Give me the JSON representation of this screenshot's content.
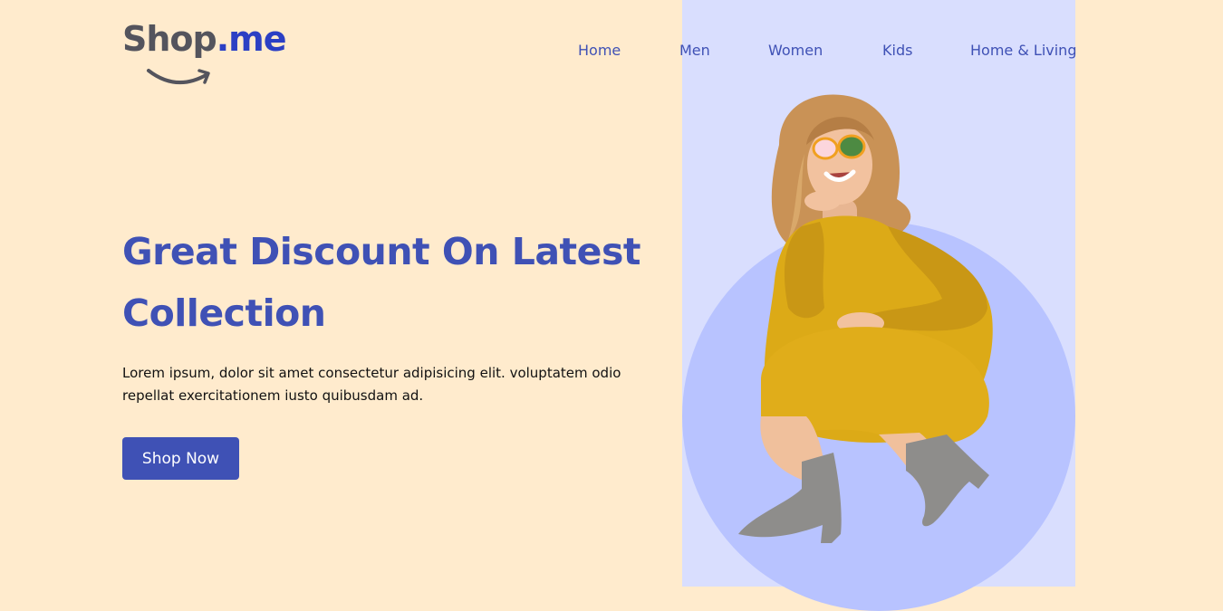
{
  "logo": {
    "part1": "Shop",
    "part2": ".me",
    "smile_icon": "smile-arrow-icon"
  },
  "nav": {
    "items": [
      {
        "label": "Home"
      },
      {
        "label": "Men"
      },
      {
        "label": "Women"
      },
      {
        "label": "Kids"
      },
      {
        "label": "Home & Living"
      }
    ]
  },
  "hero": {
    "headline_line1": "Great Discount On Latest",
    "headline_line2": "Collection",
    "description": "Lorem ipsum, dolor sit amet consectetur adipisicing elit. voluptatem odio repellat exercitationem iusto quibusdam ad.",
    "cta_label": "Shop Now",
    "image_icon": "model-photo"
  },
  "colors": {
    "background": "#FFEBCD",
    "accent": "#3F51B5",
    "panel": "#D9DEFE",
    "circle": "#B8C3FF",
    "logo_gray": "#54545D",
    "logo_blue": "#2B3FC4"
  }
}
